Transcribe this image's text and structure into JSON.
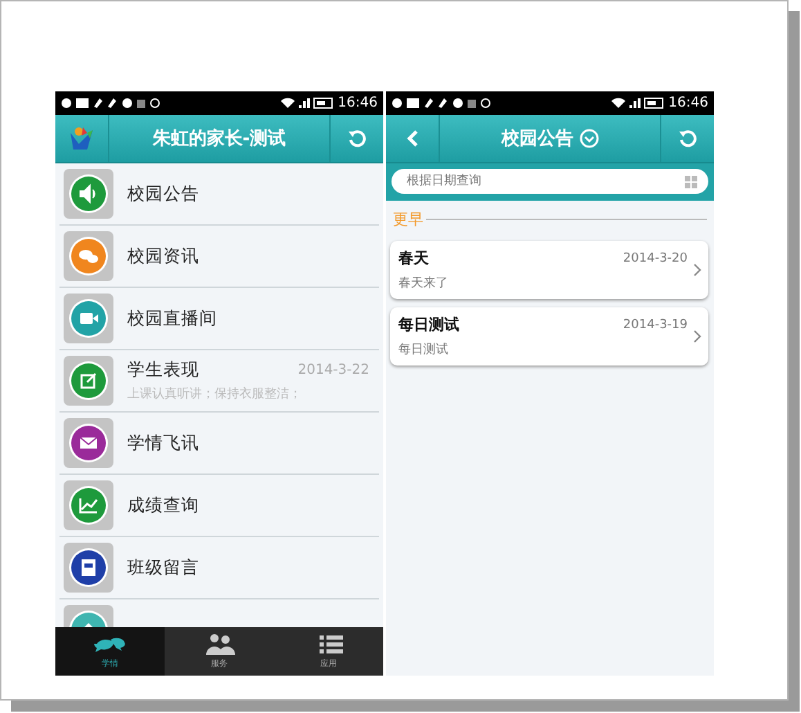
{
  "home_screen": {
    "status_time": "16:46",
    "title": "朱虹的家长-测试",
    "menu": [
      {
        "label": "校园公告",
        "kind": "speaker",
        "color": "#1e9a3c"
      },
      {
        "label": "校园资讯",
        "kind": "chat",
        "color": "#f0861e"
      },
      {
        "label": "校园直播间",
        "kind": "video",
        "color": "#22a3a6"
      },
      {
        "label": "学生表现",
        "kind": "edit",
        "color": "#1e9a3c",
        "date": "2014-3-22",
        "subtitle": "上课认真听讲；保持衣服整洁；"
      },
      {
        "label": "学情飞讯",
        "kind": "mail",
        "color": "#9a2a9a"
      },
      {
        "label": "成绩查询",
        "kind": "chart",
        "color": "#1e9a3c"
      },
      {
        "label": "班级留言",
        "kind": "board",
        "color": "#1f3fa8"
      },
      {
        "kind": "home",
        "color": "#3fb5b0"
      }
    ],
    "tabs": [
      {
        "label": "学情",
        "selected": true
      },
      {
        "label": "服务",
        "selected": false
      },
      {
        "label": "应用",
        "selected": false
      }
    ]
  },
  "notice_screen": {
    "status_time": "16:46",
    "title": "校园公告",
    "search": {
      "placeholder": "根据日期查询"
    },
    "section": "更早",
    "notices": [
      {
        "title": "春天",
        "date": "2014-3-20",
        "summary": "春天来了"
      },
      {
        "title": "每日测试",
        "date": "2014-3-19",
        "summary": "每日测试"
      }
    ]
  }
}
